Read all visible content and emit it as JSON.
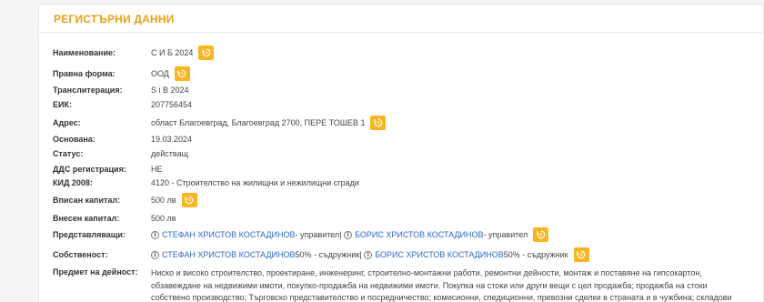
{
  "section": {
    "title": "РЕГИСТЪРНИ ДАННИ"
  },
  "fields": {
    "name": {
      "label": "Наименование:",
      "value": "С И Б 2024"
    },
    "legal_form": {
      "label": "Правна форма:",
      "value": "ООД"
    },
    "transliteration": {
      "label": "Транслитерация:",
      "value": "S i B 2024"
    },
    "eik": {
      "label": "ЕИК:",
      "value": "207756454"
    },
    "address": {
      "label": "Адрес:",
      "value": "област Благоевград, Благоевград 2700, ПЕРЕ ТОШЕВ 1"
    },
    "founded": {
      "label": "Основана:",
      "value": "19.03.2024"
    },
    "status": {
      "label": "Статус:",
      "value": "действащ"
    },
    "vat": {
      "label": "ДДС регистрация:",
      "value": "НЕ"
    },
    "kid": {
      "label": "КИД 2008:",
      "value": "4120 - Строителство на жилищни и нежилищни сгради"
    },
    "registered_capital": {
      "label": "Вписан капитал:",
      "value": "500 лв"
    },
    "paid_capital": {
      "label": "Внесен капитал:",
      "value": "500 лв"
    },
    "representatives": {
      "label": "Представляващи:",
      "people": [
        {
          "name": "СТЕФАН ХРИСТОВ КОСТАДИНОВ",
          "role": " - управител"
        },
        {
          "name": "БОРИС ХРИСТОВ КОСТАДИНОВ",
          "role": " - управител"
        }
      ],
      "separator": " | "
    },
    "ownership": {
      "label": "Собственост:",
      "owners": [
        {
          "name": "СТЕФАН ХРИСТОВ КОСТАДИНОВ",
          "share": " 50% - съдружник"
        },
        {
          "name": "БОРИС ХРИСТОВ КОСТАДИНОВ",
          "share": " 50% - съдружник"
        }
      ],
      "separator": " | "
    },
    "activity": {
      "label": "Предмет на дейност:",
      "value": "Ниско и високо строителство, проектиране, инженеринг, строително-монтажни работи, ремонтни дейности, монтаж и поставяне на гипсокартон, обзавеждане на недвижими имоти, покупко-продажба на недвижими имоти. Покупка на стоки или други вещи с цел продажба; продажба на стоки собствено производство; Търговско представителство и посредничество; комисионни, спедиционни, превозни сделки в страната и в чужбина; складови"
    }
  },
  "icons": {
    "history": "history-icon",
    "info": "info-icon"
  },
  "colors": {
    "accent": "#e8a213",
    "history_button": "#f8b722",
    "link": "#2e69c6"
  }
}
